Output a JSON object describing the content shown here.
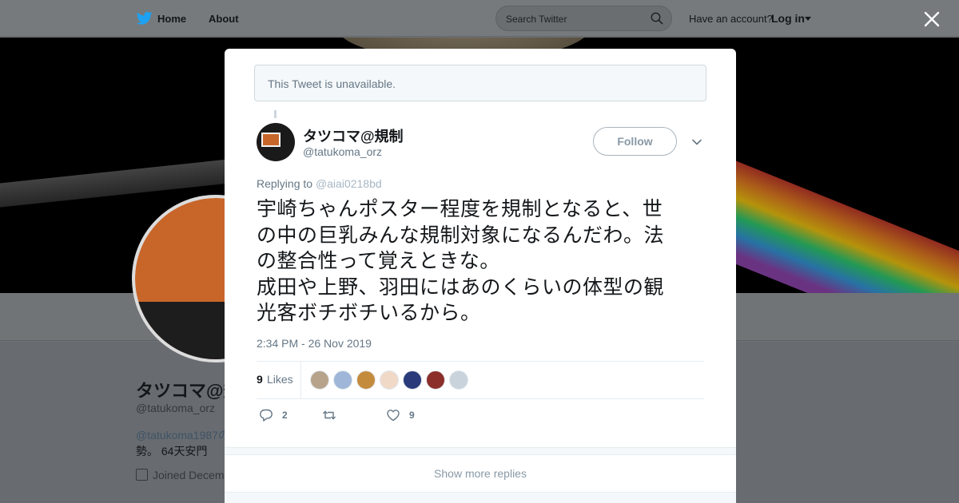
{
  "topbar": {
    "nav": [
      {
        "label": "Home"
      },
      {
        "label": "About"
      }
    ],
    "search_placeholder": "Search Twitter",
    "account_prompt": "Have an account?",
    "login_label": "Log in"
  },
  "background_profile": {
    "name": "タツコマ@規制",
    "handle": "@tatukoma_orz",
    "bio_link": "@tatukoma1987の",
    "bio_line2": "勢。 64天安門",
    "joined": "Joined Decem"
  },
  "notice": "This Tweet is unavailable.",
  "tweet": {
    "author_name": "タツコマ@規制",
    "author_handle": "@tatukoma_orz",
    "follow_label": "Follow",
    "replying_prefix": "Replying to",
    "replying_to": "@aiai0218bd",
    "lines": [
      "宇崎ちゃんポスター程度を規制となると、世",
      "の中の巨乳みんな規制対象になるんだわ。法",
      "の整合性って覚えときな。",
      "成田や上野、羽田にはあのくらいの体型の観",
      "光客ボチボチいるから。"
    ],
    "timestamp": "2:34 PM - 26 Nov 2019",
    "likes_count": "9",
    "likes_label": "Likes",
    "likers": [
      {
        "color": "#b7a38c"
      },
      {
        "color": "#9fb6d8"
      },
      {
        "color": "#c48b3c"
      },
      {
        "color": "#f1d9c8"
      },
      {
        "color": "#2a3a7a"
      },
      {
        "color": "#8c2f2a"
      },
      {
        "color": "#c9d3dc"
      }
    ],
    "reply_count": "2",
    "retweet_count": "",
    "like_count": "9"
  },
  "show_more": "Show more replies",
  "colors": {
    "accent": "#1da1f2",
    "muted": "#657786"
  }
}
